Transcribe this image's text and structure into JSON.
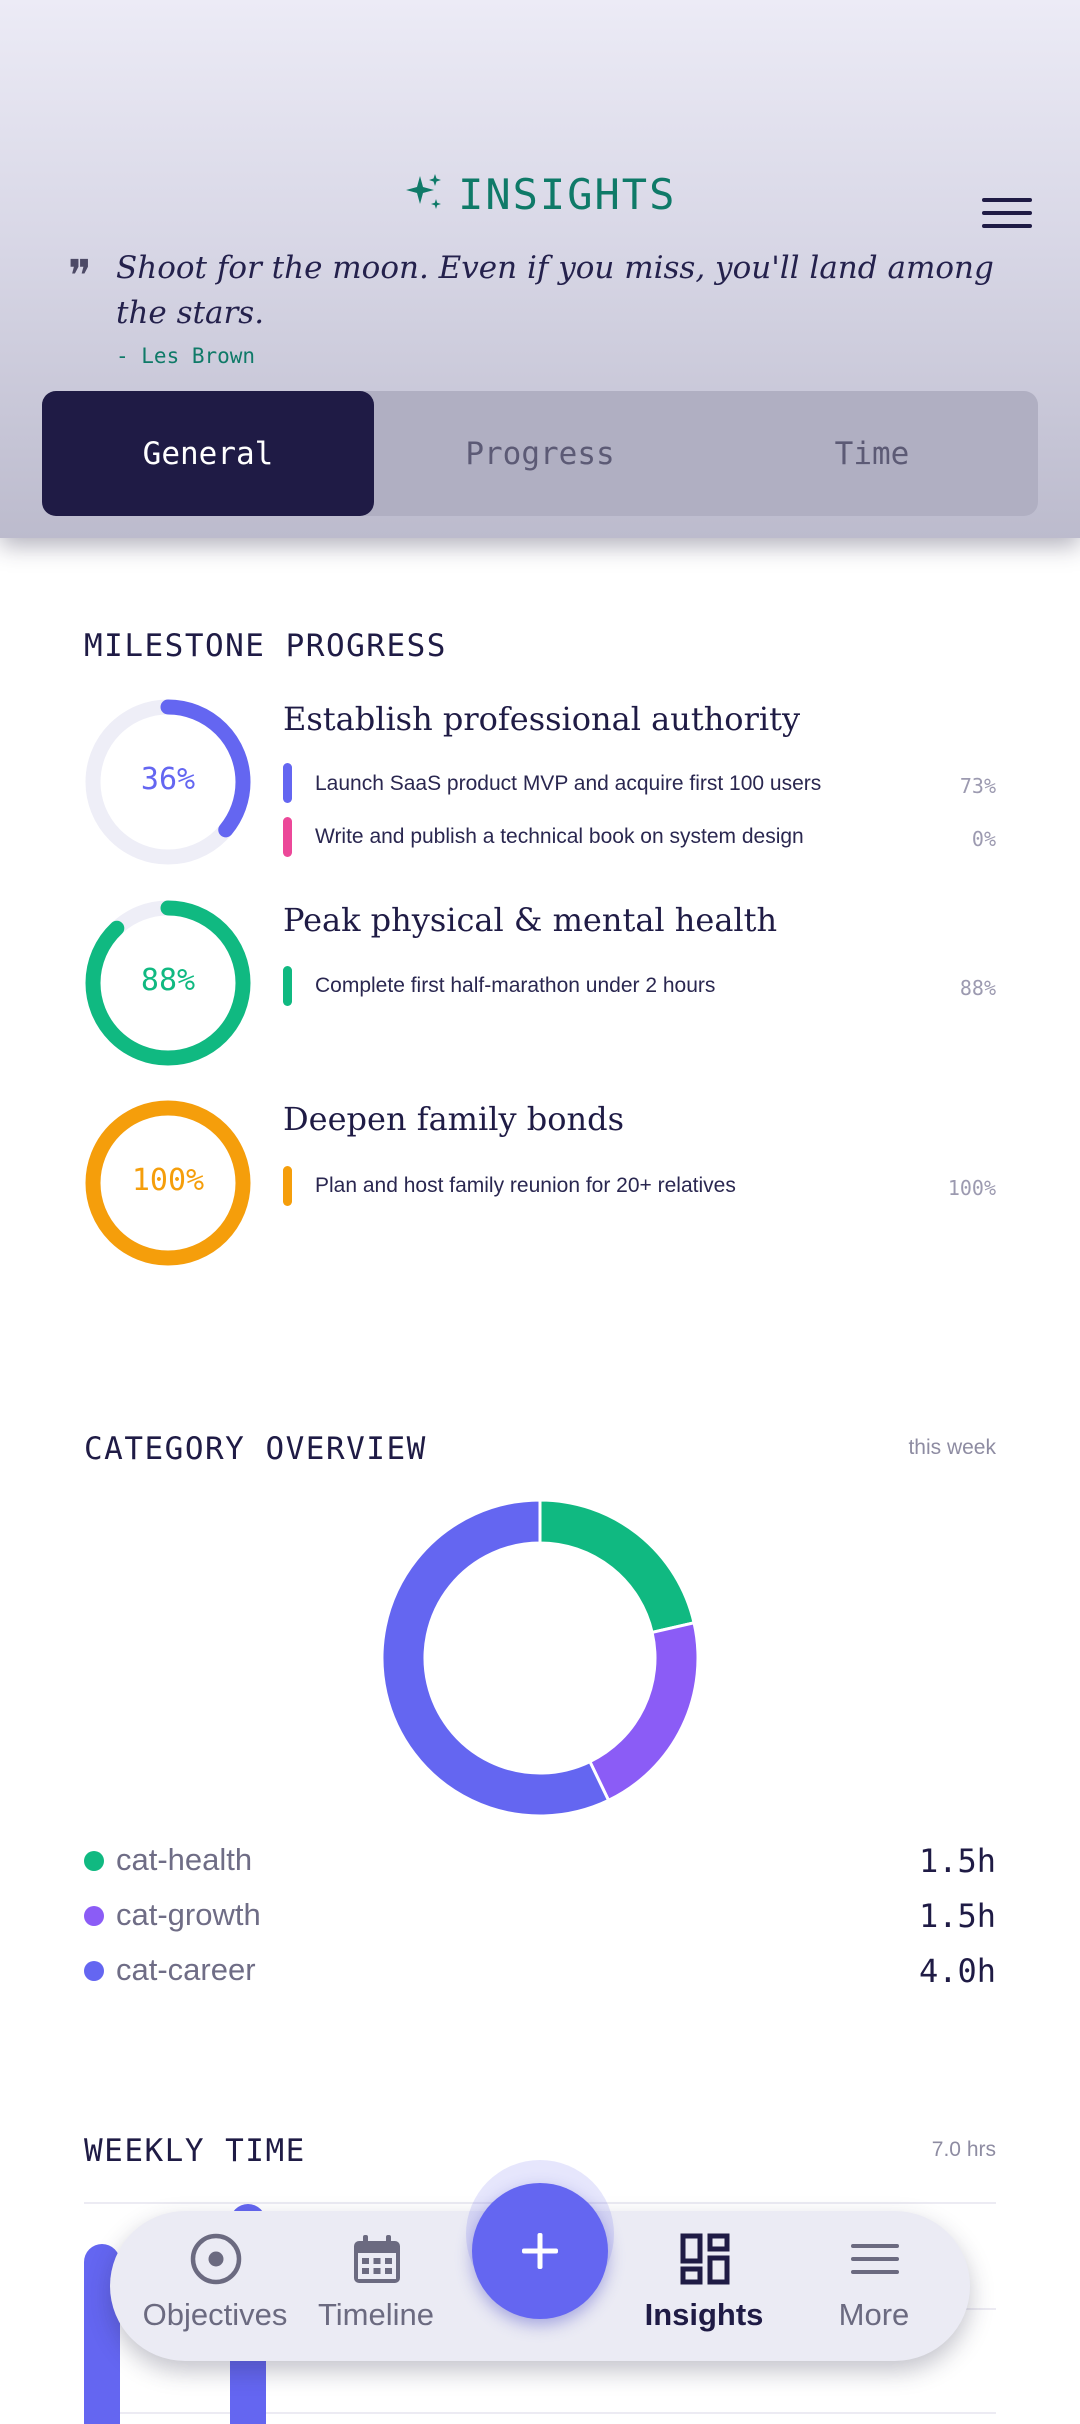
{
  "header": {
    "title": "INSIGHTS",
    "title_icon": "sparkle-icon",
    "menu_icon": "hamburger-menu-icon",
    "quote": {
      "mark": "❞",
      "text": "Shoot for the moon. Even if you miss, you'll land among the stars.",
      "author": "- Les Brown"
    },
    "tabs": [
      {
        "label": "General",
        "active": true
      },
      {
        "label": "Progress",
        "active": false
      },
      {
        "label": "Time",
        "active": false
      }
    ]
  },
  "milestone_progress": {
    "title": "MILESTONE PROGRESS",
    "goals": [
      {
        "percent_label": "36%",
        "percent": 36,
        "color": "#6466f1",
        "title": "Establish professional authority",
        "milestones": [
          {
            "text": "Launch SaaS product MVP and acquire first 100 users",
            "percent_label": "73%",
            "color": "#6466f1"
          },
          {
            "text": "Write and publish a technical book on system design",
            "percent_label": "0%",
            "color": "#ec4899"
          }
        ]
      },
      {
        "percent_label": "88%",
        "percent": 88,
        "color": "#10b981",
        "title": "Peak physical & mental health",
        "milestones": [
          {
            "text": "Complete first half-marathon under 2 hours",
            "percent_label": "88%",
            "color": "#10b981"
          }
        ]
      },
      {
        "percent_label": "100%",
        "percent": 100,
        "color": "#f59e0b",
        "title": "Deepen family bonds",
        "milestones": [
          {
            "text": "Plan and host family reunion for 20+ relatives",
            "percent_label": "100%",
            "color": "#f59e0b"
          }
        ]
      }
    ]
  },
  "category_overview": {
    "title": "CATEGORY OVERVIEW",
    "period": "this week",
    "items": [
      {
        "label": "cat-health",
        "value_label": "1.5h",
        "hours": 1.5,
        "color": "#10b981"
      },
      {
        "label": "cat-growth",
        "value_label": "1.5h",
        "hours": 1.5,
        "color": "#8b5cf6"
      },
      {
        "label": "cat-career",
        "value_label": "4.0h",
        "hours": 4.0,
        "color": "#6466f1"
      }
    ]
  },
  "weekly_time": {
    "title": "WEEKLY TIME",
    "total": "7.0 hrs"
  },
  "nav": {
    "items": [
      {
        "label": "Objectives",
        "icon": "target-icon",
        "active": false
      },
      {
        "label": "Timeline",
        "icon": "calendar-icon",
        "active": false
      },
      {
        "label": "Insights",
        "icon": "dashboard-icon",
        "active": true
      },
      {
        "label": "More",
        "icon": "menu-icon",
        "active": false
      }
    ],
    "fab_icon": "plus-icon",
    "fab_label": "+"
  },
  "chart_data": {
    "type": "pie",
    "title": "CATEGORY OVERVIEW",
    "categories": [
      "cat-health",
      "cat-growth",
      "cat-career"
    ],
    "values": [
      1.5,
      1.5,
      4.0
    ],
    "colors": [
      "#10b981",
      "#8b5cf6",
      "#6466f1"
    ],
    "unit": "h"
  }
}
